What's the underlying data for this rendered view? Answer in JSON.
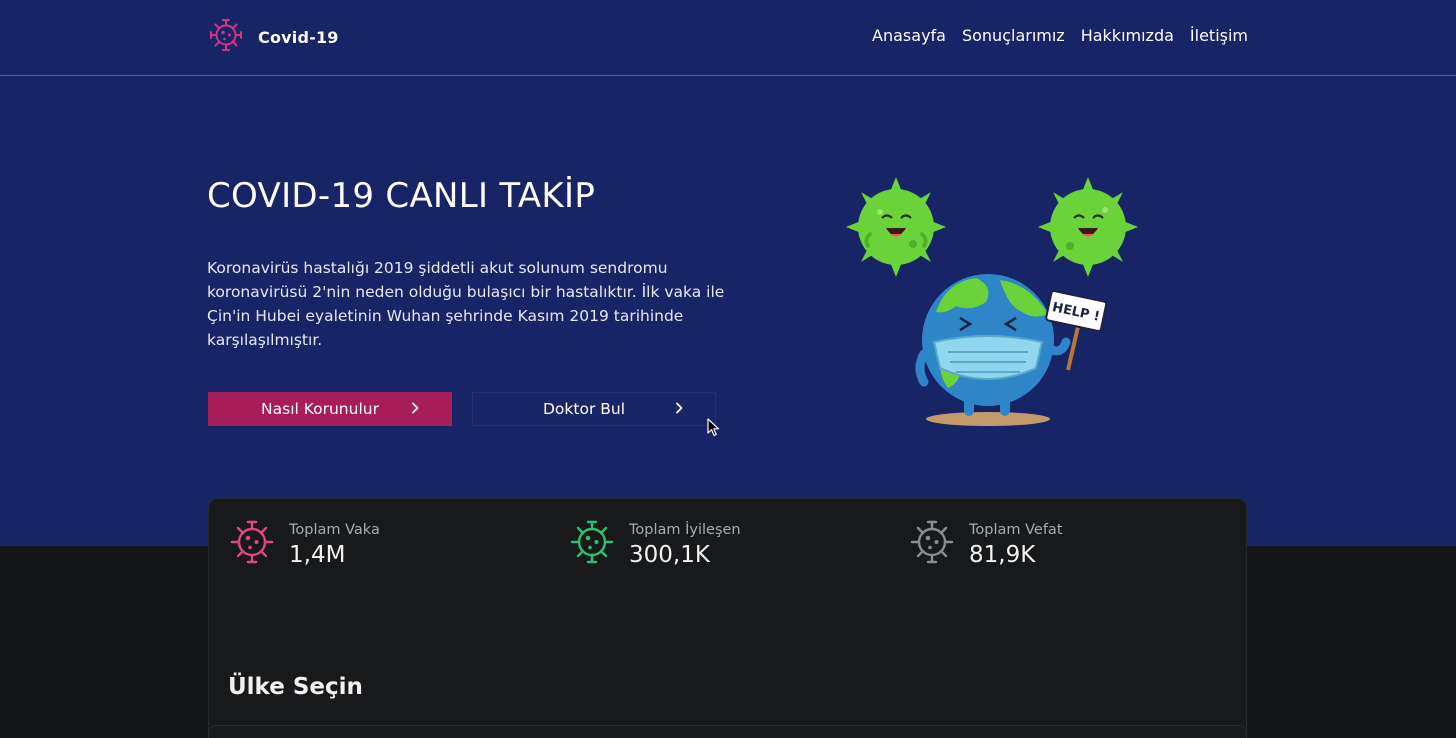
{
  "brand": {
    "name": "Covid-19",
    "icon": "virus-icon",
    "color": "#d63384"
  },
  "nav": {
    "items": [
      {
        "label": "Anasayfa"
      },
      {
        "label": "Sonuçlarımız"
      },
      {
        "label": "Hakkımızda"
      },
      {
        "label": "İletişim"
      }
    ]
  },
  "hero": {
    "title": "COVID-19 CANLI TAKİP",
    "description": "Koronavirüs hastalığı 2019 şiddetli akut solunum sendromu koronavirüsü 2'nin neden olduğu bulaşıcı bir hastalıktır. İlk vaka ile Çin'in Hubei eyaletinin Wuhan şehrinde Kasım 2019 tarihinde karşılaşılmıştır.",
    "primary_button": "Nasıl Korunulur",
    "secondary_button": "Doktor Bul",
    "sign_text": "HELP !"
  },
  "stats": [
    {
      "label": "Toplam Vaka",
      "value": "1,4M",
      "color": "#e2467f",
      "icon": "virus-icon"
    },
    {
      "label": "Toplam İyileşen",
      "value": "300,1K",
      "color": "#2fbf71",
      "icon": "virus-icon"
    },
    {
      "label": "Toplam Vefat",
      "value": "81,9K",
      "color": "#8b8c8f",
      "icon": "virus-icon"
    }
  ],
  "country_section": {
    "title": "Ülke Seçin"
  },
  "colors": {
    "hero_bg": "#172466",
    "page_bg": "#161719",
    "primary_button": "#a71d58",
    "virus_green": "#6ad33a"
  }
}
